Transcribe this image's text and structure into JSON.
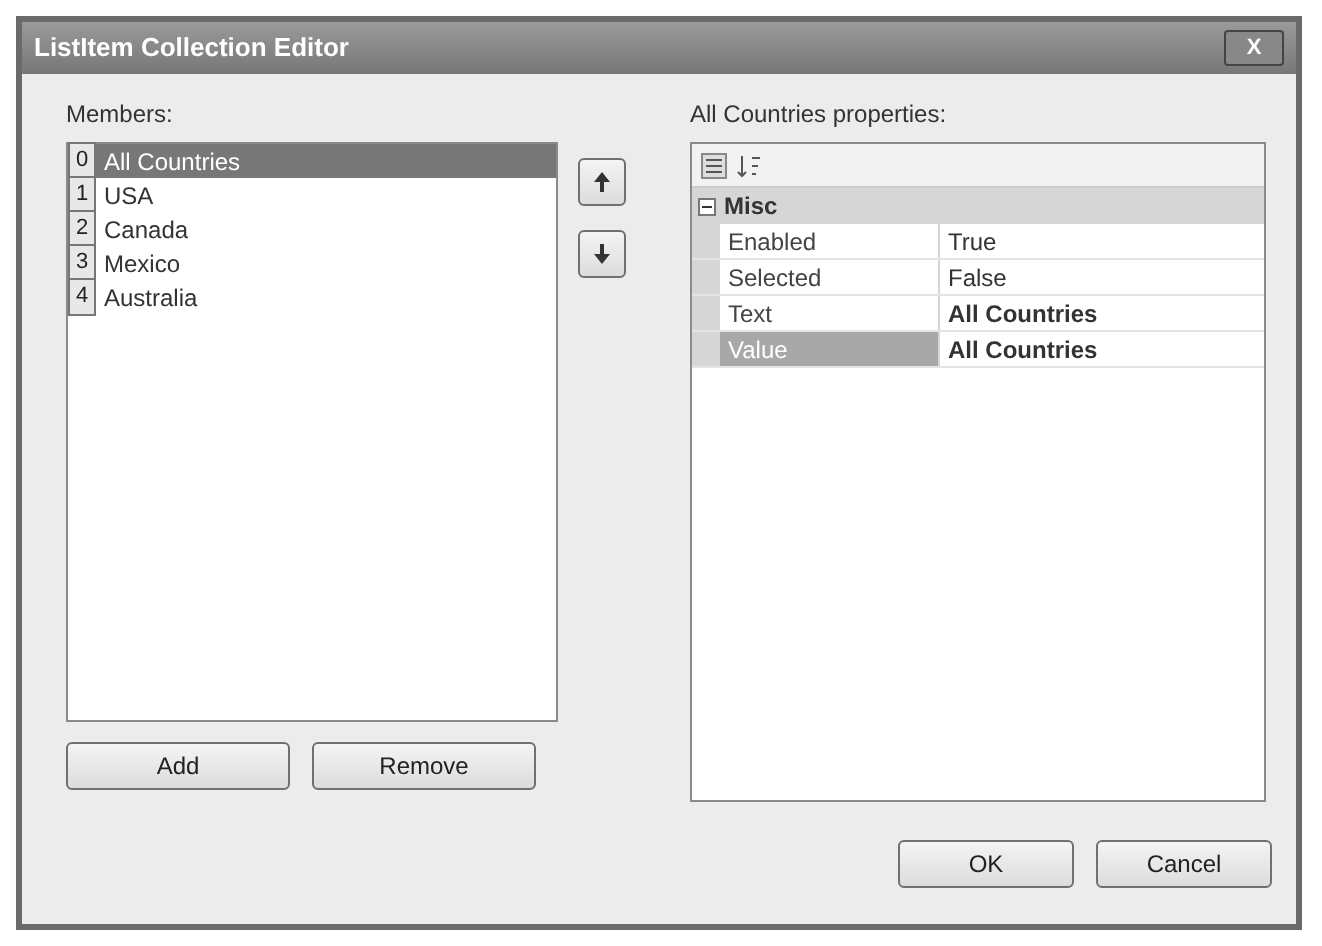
{
  "window": {
    "title": "ListItem Collection Editor",
    "close": "X"
  },
  "members": {
    "label": "Members:",
    "items": [
      {
        "index": "0",
        "name": "All Countries",
        "selected": true
      },
      {
        "index": "1",
        "name": "USA",
        "selected": false
      },
      {
        "index": "2",
        "name": "Canada",
        "selected": false
      },
      {
        "index": "3",
        "name": "Mexico",
        "selected": false
      },
      {
        "index": "4",
        "name": "Australia",
        "selected": false
      }
    ]
  },
  "properties": {
    "label": "All Countries properties:",
    "category": "Misc",
    "expanded": true,
    "rows": [
      {
        "name": "Enabled",
        "value": "True",
        "selected": false,
        "bold": false
      },
      {
        "name": "Selected",
        "value": "False",
        "selected": false,
        "bold": false
      },
      {
        "name": "Text",
        "value": "All Countries",
        "selected": false,
        "bold": true
      },
      {
        "name": "Value",
        "value": "All Countries",
        "selected": true,
        "bold": true
      }
    ]
  },
  "list_buttons": [
    "Add",
    "Remove"
  ],
  "dialog_buttons": [
    "OK",
    "Cancel"
  ]
}
